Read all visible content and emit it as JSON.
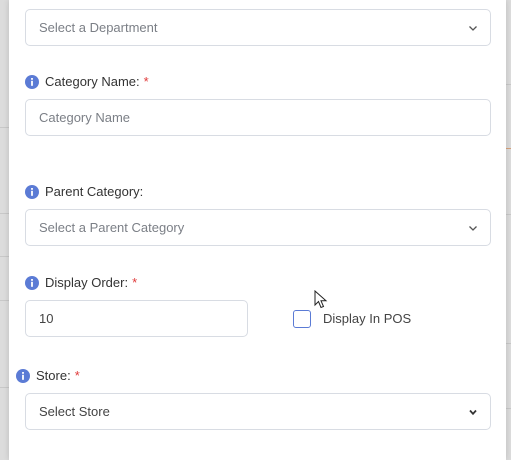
{
  "department": {
    "placeholder": "Select a Department"
  },
  "category_name": {
    "label": "Category Name:",
    "required": "*",
    "placeholder": "Category Name"
  },
  "parent_category": {
    "label": "Parent Category:",
    "placeholder": "Select a Parent Category"
  },
  "display_order": {
    "label": "Display Order:",
    "required": "*",
    "value": "10"
  },
  "display_in_pos": {
    "label": "Display In POS",
    "checked": false
  },
  "store": {
    "label": "Store:",
    "required": "*",
    "placeholder": "Select Store"
  },
  "colors": {
    "info": "#5b7bd5",
    "required": "#e03a3a",
    "border": "#d8dce3"
  }
}
